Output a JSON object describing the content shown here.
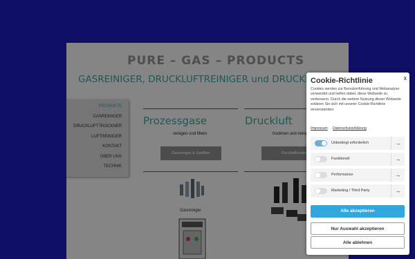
{
  "site": {
    "brand": "PURE – GAS – PRODUCTS",
    "tagline": "GASREINIGER, DRUCKLUFTREINIGER und DRUCKLUFTTROCKNER"
  },
  "nav": {
    "items": [
      "PRODUKTE",
      "GASREINIGER",
      "DRUCKLUFTTROCKNER",
      "LUFTREINIGER",
      "KONTAKT",
      "ÜBER UNS",
      "TECHNIK"
    ]
  },
  "columns": {
    "left": {
      "title": "Prozessgase",
      "subtitle": "reinigen und filtern",
      "button": "Gasreiniger &      Gasfilter",
      "caption": "Gasreiniger"
    },
    "right": {
      "title": "Druckluft",
      "subtitle": "trocknen und reinigen",
      "button": "Drucklufttrockner & Reiniger"
    }
  },
  "cookie": {
    "title": "Cookie-Richtlinie",
    "close": "x",
    "text": "Cookies werden zur Benutzerführung und Webanalyse verwendet und helfen dabei, diese Webseite zu verbessern. Durch die weitere Nutzung dieser Webseite erklären Sie sich mit unserer Cookie-Richtlinie einverstanden.",
    "links": [
      "Impressum",
      "Datenschutzerklärung"
    ],
    "categories": [
      {
        "label": "Unbedingt erforderlich",
        "enabled": true
      },
      {
        "label": "Funktionell",
        "enabled": false
      },
      {
        "label": "Performance",
        "enabled": false
      },
      {
        "label": "Marketing / Third Party",
        "enabled": false
      }
    ],
    "accept_all": "Alle akzeptieren",
    "accept_selection": "Nur Auswahl akzeptieren",
    "reject_all": "Alle ablehnen"
  }
}
